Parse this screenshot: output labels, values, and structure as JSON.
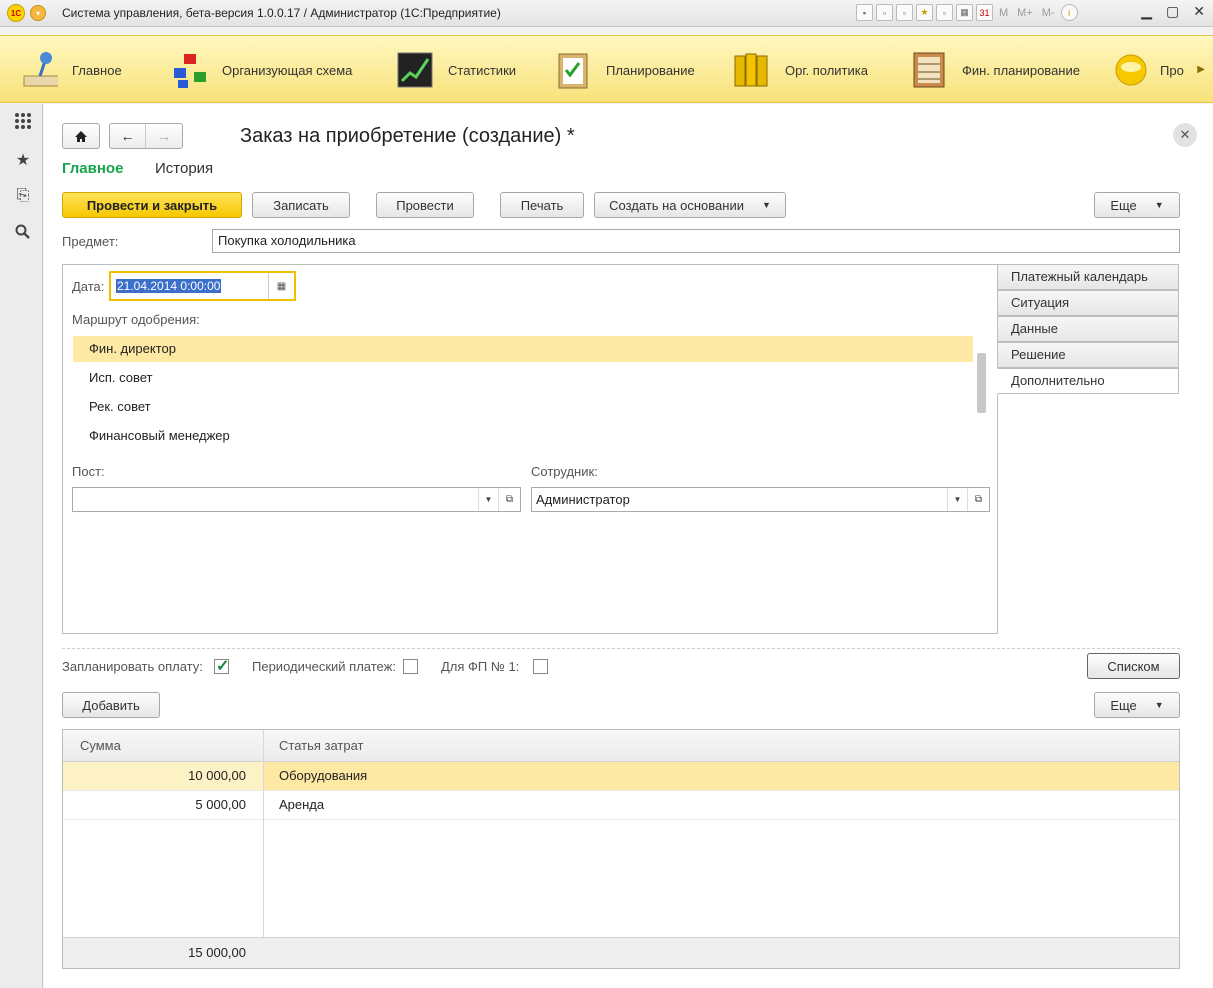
{
  "window": {
    "title": "Система управления, бета-версия 1.0.0.17 / Администратор  (1С:Предприятие)",
    "toolbar_m": [
      "M",
      "M+",
      "M-"
    ]
  },
  "sections": [
    {
      "label": "Главное",
      "icon": "desk-lamp-icon"
    },
    {
      "label": "Организующая схема",
      "icon": "org-chart-icon"
    },
    {
      "label": "Статистики",
      "icon": "chart-icon"
    },
    {
      "label": "Планирование",
      "icon": "clipboard-icon"
    },
    {
      "label": "Орг. политика",
      "icon": "binders-icon"
    },
    {
      "label": "Фин. планирование",
      "icon": "abacus-icon"
    },
    {
      "label": "Про",
      "icon": "disc-icon"
    }
  ],
  "form": {
    "title": "Заказ на приобретение (создание) *",
    "tabs": {
      "main": "Главное",
      "history": "История"
    },
    "buttons": {
      "post_close": "Провести и закрыть",
      "save": "Записать",
      "post": "Провести",
      "print": "Печать",
      "create_based": "Создать на основании",
      "more": "Еще",
      "list": "Списком",
      "add": "Добавить",
      "more2": "Еще"
    },
    "subject_label": "Предмет:",
    "subject_value": "Покупка холодильника",
    "date_label": "Дата:",
    "date_value": "21.04.2014  0:00:00",
    "route_label": "Маршрут одобрения:",
    "route_items": [
      "Фин. директор",
      "Исп. совет",
      "Рек. совет",
      "Финансовый менеджер"
    ],
    "post_label": "Пост:",
    "post_value": "",
    "employee_label": "Сотрудник:",
    "employee_value": "Администратор",
    "side_tabs": [
      "Платежный календарь",
      "Ситуация",
      "Данные",
      "Решение",
      "Дополнительно"
    ],
    "checks": {
      "plan_payment": {
        "label": "Запланировать оплату:",
        "checked": true
      },
      "periodic": {
        "label": "Периодический платеж:",
        "checked": false
      },
      "fp1": {
        "label": "Для ФП № 1:",
        "checked": false
      }
    },
    "table": {
      "headers": [
        "Сумма",
        "Статья затрат"
      ],
      "rows": [
        {
          "sum": "10 000,00",
          "item": "Оборудования"
        },
        {
          "sum": "5 000,00",
          "item": "Аренда"
        }
      ],
      "total": "15 000,00"
    }
  },
  "colors": {
    "accent_green": "#16a34a",
    "primary_button": "#f6c800",
    "selection": "#fde9a3"
  }
}
